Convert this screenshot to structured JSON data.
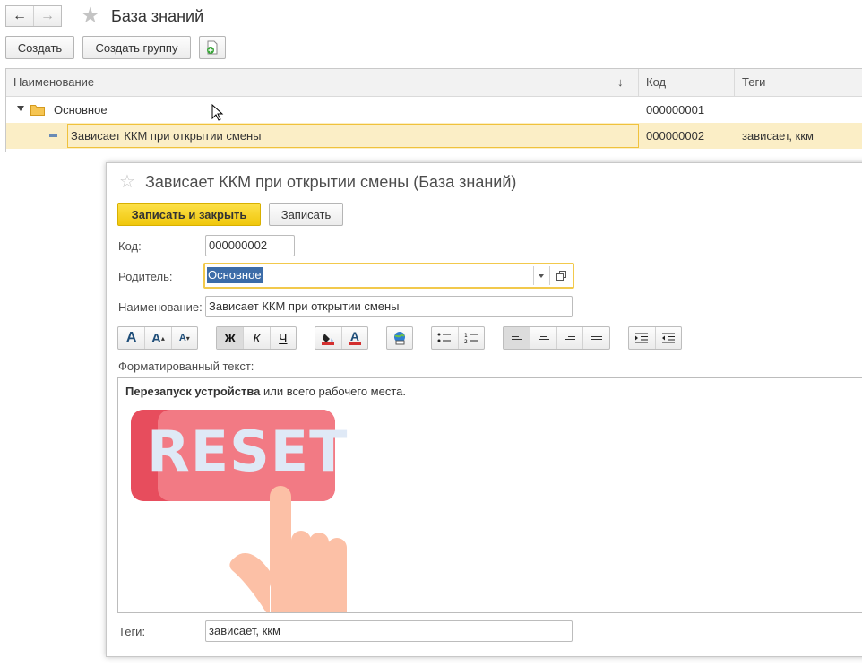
{
  "window": {
    "title": "База знаний"
  },
  "nav": {
    "back_icon": "arrow-left-icon",
    "forward_icon": "arrow-right-icon",
    "favorite_icon": "star-icon"
  },
  "toolbar": {
    "create_label": "Создать",
    "create_group_label": "Создать группу",
    "add_icon": "add-document-icon"
  },
  "table": {
    "columns": [
      "Наименование",
      "Код",
      "Теги"
    ],
    "sort_indicator": "↓",
    "rows": [
      {
        "name": "Основное",
        "code": "000000001",
        "tags": "",
        "type": "folder"
      },
      {
        "name": "Зависает ККМ при открытии смены",
        "code": "000000002",
        "tags": "зависает, ккм",
        "type": "item",
        "selected": true
      }
    ]
  },
  "form": {
    "title": "Зависает ККМ при открытии смены (База знаний)",
    "save_close_label": "Записать и закрыть",
    "save_label": "Записать",
    "code_label": "Код:",
    "code_value": "000000002",
    "parent_label": "Родитель:",
    "parent_value": "Основное",
    "name_label": "Наименование:",
    "name_value": "Зависает ККМ при открытии смены",
    "formatting": {
      "bold": "Ж",
      "italic": "К",
      "underline": "Ч",
      "font_a": "A",
      "font_larger": "A",
      "font_smaller": "A",
      "text_color": "A"
    },
    "rich_text_label": "Форматированный текст:",
    "rich_text": {
      "bold_part": "Перезапуск устройства",
      "rest": " или всего рабочего места."
    },
    "image_text": "RESET",
    "tags_label": "Теги:",
    "tags_value": "зависает, ккм"
  },
  "colors": {
    "accent_yellow": "#f5d20f",
    "selected_row": "#fbeec6",
    "reset_button": "#f0707b",
    "hand": "#fcc0a6"
  }
}
